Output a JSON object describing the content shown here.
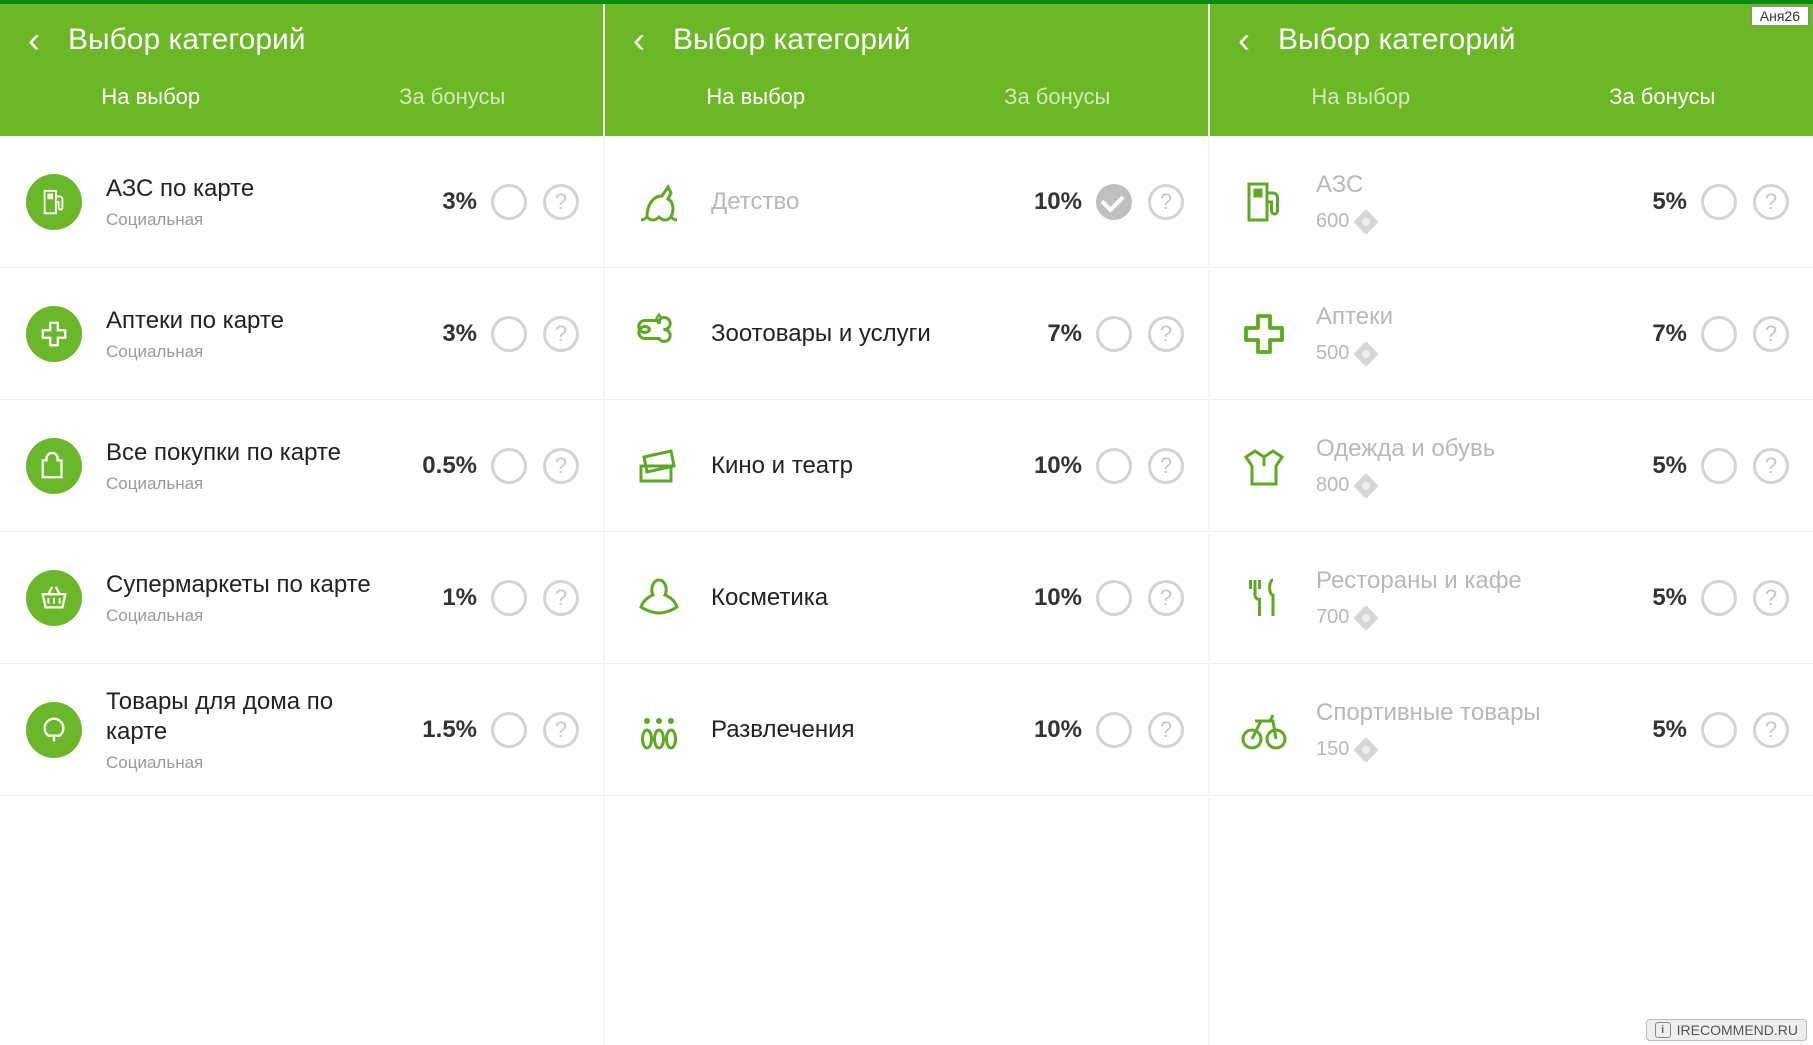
{
  "user_tag": "Аня26",
  "site_tag": "IRECOMMEND.RU",
  "header": {
    "title": "Выбор категорий",
    "tabs": {
      "choice": "На выбор",
      "bonus": "За бонусы"
    }
  },
  "help_glyph": "?",
  "panels": [
    {
      "active_tab": "choice",
      "items": [
        {
          "icon": "fuel",
          "style": "filled",
          "title": "АЗС по карте",
          "sub": "Социальная",
          "pct": "3%",
          "checked": false
        },
        {
          "icon": "cross",
          "style": "filled",
          "title": "Аптеки по карте",
          "sub": "Социальная",
          "pct": "3%",
          "checked": false
        },
        {
          "icon": "bag",
          "style": "filled",
          "title": "Все покупки по карте",
          "sub": "Социальная",
          "pct": "0.5%",
          "checked": false
        },
        {
          "icon": "basket",
          "style": "filled",
          "title": "Супермаркеты по карте",
          "sub": "Социальная",
          "pct": "1%",
          "checked": false
        },
        {
          "icon": "lamp",
          "style": "filled",
          "title": "Товары для дома по карте",
          "sub": "Социальная",
          "pct": "1.5%",
          "checked": false
        }
      ]
    },
    {
      "active_tab": "choice",
      "items": [
        {
          "icon": "horse",
          "style": "outline",
          "title": "Детство",
          "muted": true,
          "pct": "10%",
          "checked": true
        },
        {
          "icon": "bone",
          "style": "outline",
          "title": "Зоотовары и услуги",
          "pct": "7%",
          "checked": false
        },
        {
          "icon": "tickets",
          "style": "outline",
          "title": "Кино и театр",
          "pct": "10%",
          "checked": false
        },
        {
          "icon": "lotus",
          "style": "outline",
          "title": "Косметика",
          "pct": "10%",
          "checked": false
        },
        {
          "icon": "bowling",
          "style": "outline",
          "title": "Развлечения",
          "pct": "10%",
          "checked": false
        }
      ]
    },
    {
      "active_tab": "bonus",
      "items": [
        {
          "icon": "fuel",
          "style": "outline",
          "title": "АЗС",
          "muted": true,
          "cost": "600",
          "pct": "5%",
          "checked": false
        },
        {
          "icon": "cross",
          "style": "outline",
          "title": "Аптеки",
          "muted": true,
          "cost": "500",
          "pct": "7%",
          "checked": false
        },
        {
          "icon": "shirt",
          "style": "outline",
          "title": "Одежда и обувь",
          "muted": true,
          "cost": "800",
          "pct": "5%",
          "checked": false
        },
        {
          "icon": "cutlery",
          "style": "outline",
          "title": "Рестораны и кафе",
          "muted": true,
          "cost": "700",
          "pct": "5%",
          "checked": false
        },
        {
          "icon": "bike",
          "style": "outline",
          "title": "Спортивные товары",
          "muted": true,
          "cost": "150",
          "pct": "5%",
          "checked": false
        }
      ]
    }
  ]
}
